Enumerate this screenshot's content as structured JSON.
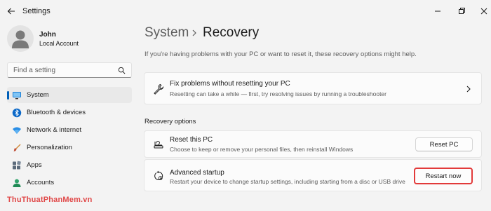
{
  "window": {
    "title": "Settings"
  },
  "profile": {
    "name": "John",
    "account_type": "Local Account"
  },
  "search": {
    "placeholder": "Find a setting"
  },
  "sidebar": {
    "items": [
      {
        "label": "System",
        "icon": "system-icon",
        "active": true
      },
      {
        "label": "Bluetooth & devices",
        "icon": "bluetooth-icon",
        "active": false
      },
      {
        "label": "Network & internet",
        "icon": "network-icon",
        "active": false
      },
      {
        "label": "Personalization",
        "icon": "personalization-icon",
        "active": false
      },
      {
        "label": "Apps",
        "icon": "apps-icon",
        "active": false
      },
      {
        "label": "Accounts",
        "icon": "accounts-icon",
        "active": false
      }
    ]
  },
  "watermark": "ThuThuatPhanMem.vn",
  "breadcrumb": {
    "parent": "System",
    "current": "Recovery"
  },
  "intro": "If you're having problems with your PC or want to reset it, these recovery options might help.",
  "fix_card": {
    "title": "Fix problems without resetting your PC",
    "description": "Resetting can take a while — first, try resolving issues by running a troubleshooter"
  },
  "recovery_options": {
    "section_title": "Recovery options",
    "reset": {
      "title": "Reset this PC",
      "description": "Choose to keep or remove your personal files, then reinstall Windows",
      "button": "Reset PC"
    },
    "advanced": {
      "title": "Advanced startup",
      "description": "Restart your device to change startup settings, including starting from a disc or USB drive",
      "button": "Restart now"
    }
  },
  "colors": {
    "accent": "#005fb8",
    "highlight_border": "#e23a3a",
    "background": "#f3f3f3",
    "card": "#fbfbfb"
  }
}
